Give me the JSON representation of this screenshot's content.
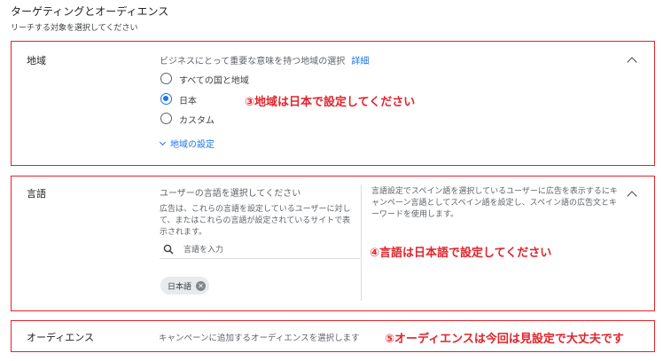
{
  "header": {
    "title": "ターゲティングとオーディエンス",
    "subtitle": "リーチする対象を選択してください"
  },
  "region": {
    "label": "地域",
    "description": "ビジネスにとって重要な意味を持つ地域の選択",
    "detail_link": "詳細",
    "options": [
      {
        "label": "すべての国と地域",
        "selected": false
      },
      {
        "label": "日本",
        "selected": true
      },
      {
        "label": "カスタム",
        "selected": false
      }
    ],
    "settings_link": "地域の設定",
    "annotation": "③地域は日本で設定してください"
  },
  "language": {
    "label": "言語",
    "prompt": "ユーザーの言語を選択してください",
    "help_text": "広告は、これらの言語を設定しているユーザーに対して、またはこれらの言語が設定されているサイトで表示されます。",
    "search_placeholder": "言語を入力",
    "chips": [
      "日本語"
    ],
    "side_note": "言語設定でスペイン語を選択しているユーザーに広告を表示するにキャンペーン言語としてスペイン語を設定し、スペイン語の広告文とキーワードを使用します。",
    "annotation": "④言語は日本語で設定してください"
  },
  "audience": {
    "label": "オーディエンス",
    "description": "キャンペーンに追加するオーディエンスを選択します",
    "annotation": "⑤オーディエンスは今回は見設定で大丈夫です"
  },
  "colors": {
    "annotation_red": "#e0242b",
    "accent_blue": "#1a73e8"
  },
  "icons": {
    "collapse": "chevron-up-icon",
    "expand": "chevron-down-icon",
    "search": "search-icon",
    "remove_chip": "close-circle-icon"
  }
}
